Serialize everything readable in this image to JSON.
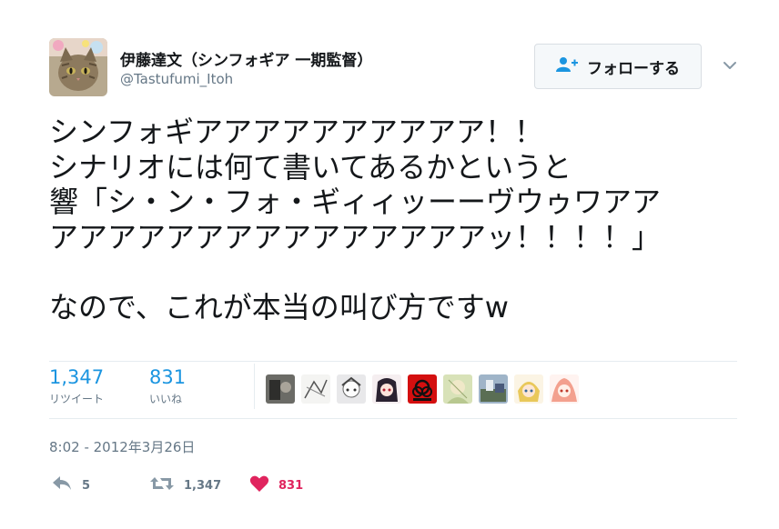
{
  "user": {
    "display_name": "伊藤達文（シンフォギア 一期監督）",
    "handle": "@Tastufumi_Itoh"
  },
  "follow_button": {
    "label": "フォローする",
    "icon": "add-user-icon"
  },
  "tweet": {
    "lines": [
      "シンフォギアアアアアアアアアア！！",
      "シナリオには何て書いてあるかというと",
      "響「シ・ン・フォ・ギィィッーーヴウゥワアア",
      "アアアアアアアアアアアアアアアッ！！！！」",
      "",
      "なので、これが本当の叫び方ですw"
    ]
  },
  "stats": {
    "retweets": {
      "count": "1,347",
      "label": "リツイート"
    },
    "likes": {
      "count": "831",
      "label": "いいね"
    }
  },
  "timestamp": "8:02 - 2012年3月26日",
  "actions": {
    "reply": {
      "icon": "reply-icon",
      "count": "5"
    },
    "retweet": {
      "icon": "retweet-icon",
      "count": "1,347"
    },
    "like": {
      "icon": "heart-icon",
      "count": "831"
    }
  },
  "colors": {
    "link_blue": "#1b95e0",
    "muted_gray": "#657786",
    "like_red": "#e0245e",
    "text": "#14171a"
  }
}
